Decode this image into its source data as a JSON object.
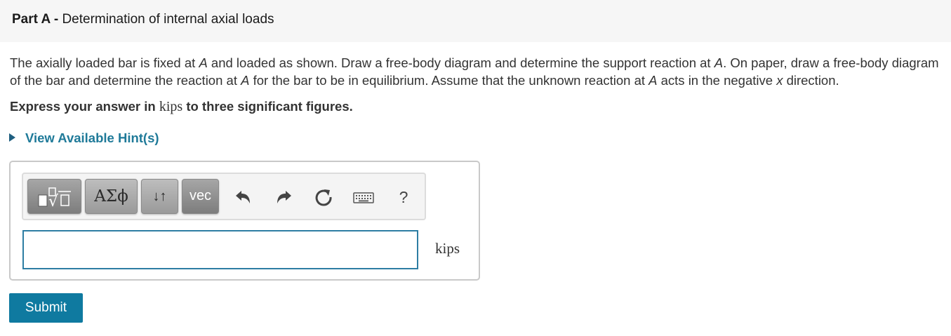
{
  "part": {
    "label": "Part A -",
    "title": "Determination of internal axial loads"
  },
  "question": {
    "s1": "The axially loaded bar is fixed at ",
    "v1": "A",
    "s2": " and loaded as shown. Draw a free-body diagram and determine the support reaction at ",
    "v2": "A",
    "s3": ". On paper, draw a free-body diagram of the bar and determine the reaction at ",
    "v3": "A",
    "s4": " for the bar to be in equilibrium. Assume that the unknown reaction at ",
    "v4": "A",
    "s5": " acts in the negative ",
    "v5": "x",
    "s6": " direction."
  },
  "instruction": {
    "before": "Express your answer in ",
    "unit": "kips",
    "after": " to three significant figures."
  },
  "hints": {
    "label": "View Available Hint(s)"
  },
  "toolbar": {
    "greek_label": "ΑΣϕ",
    "arrows_label": "↓↑",
    "vec_label": "vec",
    "help_label": "?",
    "icons": [
      "templates-icon",
      "undo-icon",
      "redo-icon",
      "reset-icon",
      "keyboard-icon"
    ]
  },
  "answer": {
    "value": "",
    "unit": "kips"
  },
  "submit": {
    "label": "Submit"
  },
  "colors": {
    "link": "#1f7a99",
    "button": "#0f7aa0",
    "input_border": "#2d7da3",
    "header_bg": "#f6f6f6"
  }
}
